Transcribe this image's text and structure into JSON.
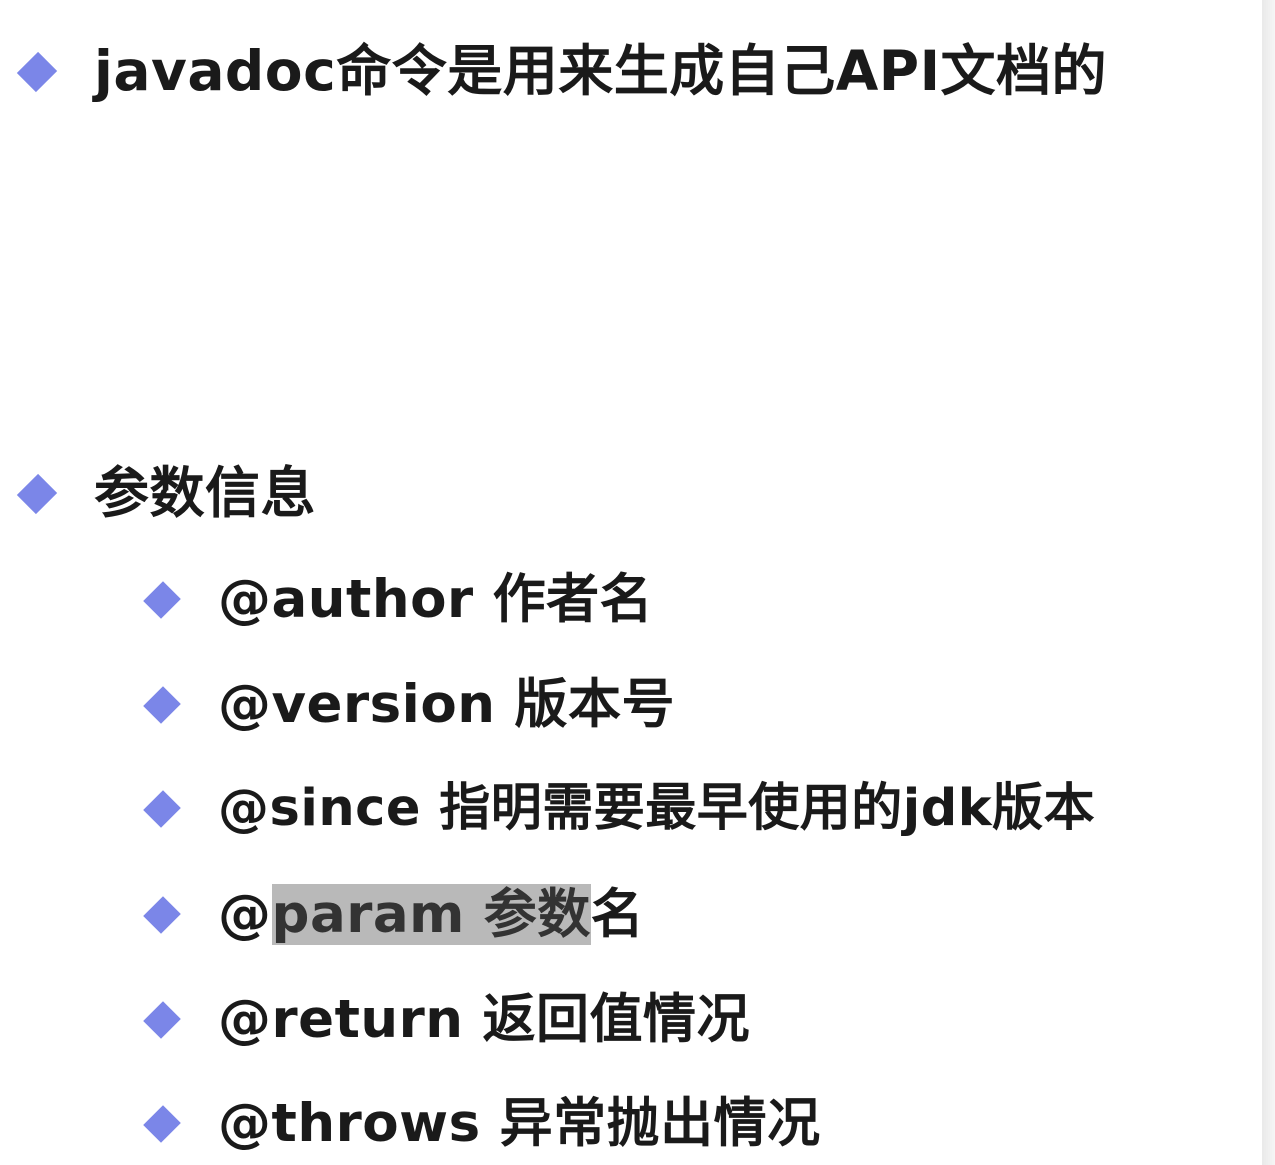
{
  "heading_bullet": {
    "text": "javadoc命令是用来生成自己API文档的"
  },
  "params_bullet": {
    "text": "参数信息"
  },
  "tags": [
    {
      "tag": "@author",
      "desc": "作者名"
    },
    {
      "tag": "@version",
      "desc": "版本号"
    },
    {
      "tag": "@since",
      "desc": "指明需要最早使用的jdk版本"
    },
    {
      "tag_prefix": "@",
      "highlighted": "param 参数",
      "rest": "名"
    },
    {
      "tag": "@return",
      "desc": "返回值情况"
    },
    {
      "tag": "@throws",
      "desc": "异常抛出情况"
    }
  ],
  "colors": {
    "bullet": "#7b86e8",
    "highlight": "#b9b9b9"
  }
}
